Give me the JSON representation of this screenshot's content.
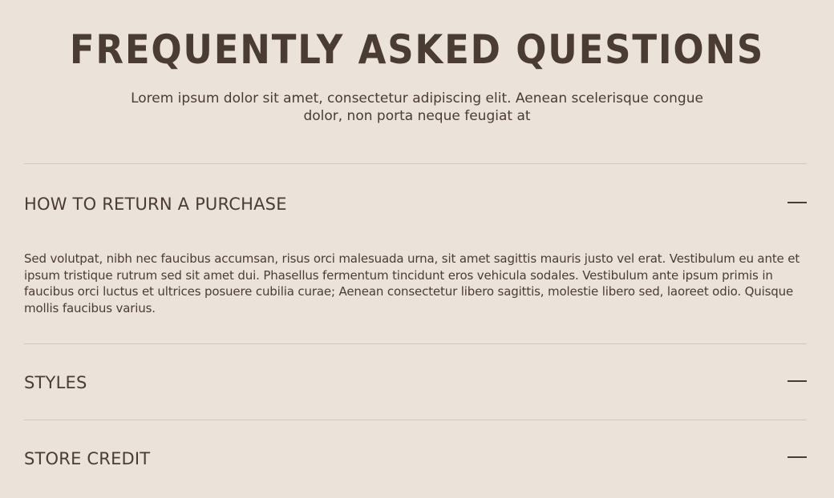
{
  "title": "FREQUENTLY ASKED QUESTIONS",
  "subtitle": "Lorem ipsum dolor sit amet, consectetur adipiscing elit. Aenean scelerisque congue dolor, non porta neque feugiat at",
  "faq": [
    {
      "question": "HOW TO RETURN A PURCHASE",
      "expanded": true,
      "answer": "Sed volutpat, nibh nec faucibus accumsan, risus orci malesuada urna, sit amet sagittis mauris justo vel erat. Vestibulum eu ante et ipsum tristique rutrum sed sit amet dui. Phasellus fermentum tincidunt eros vehicula sodales. Vestibulum ante ipsum primis in faucibus orci luctus et ultrices posuere cubilia curae; Aenean consectetur libero sagittis, molestie libero sed, laoreet odio. Quisque mollis faucibus varius.",
      "icon": "minus-icon"
    },
    {
      "question": "STYLES",
      "expanded": false,
      "icon": "minus-icon"
    },
    {
      "question": "STORE CREDIT",
      "expanded": false,
      "icon": "minus-icon"
    }
  ],
  "colors": {
    "background": "#ebe2da",
    "text": "#4a3c33",
    "divider": "#cfc6be"
  }
}
